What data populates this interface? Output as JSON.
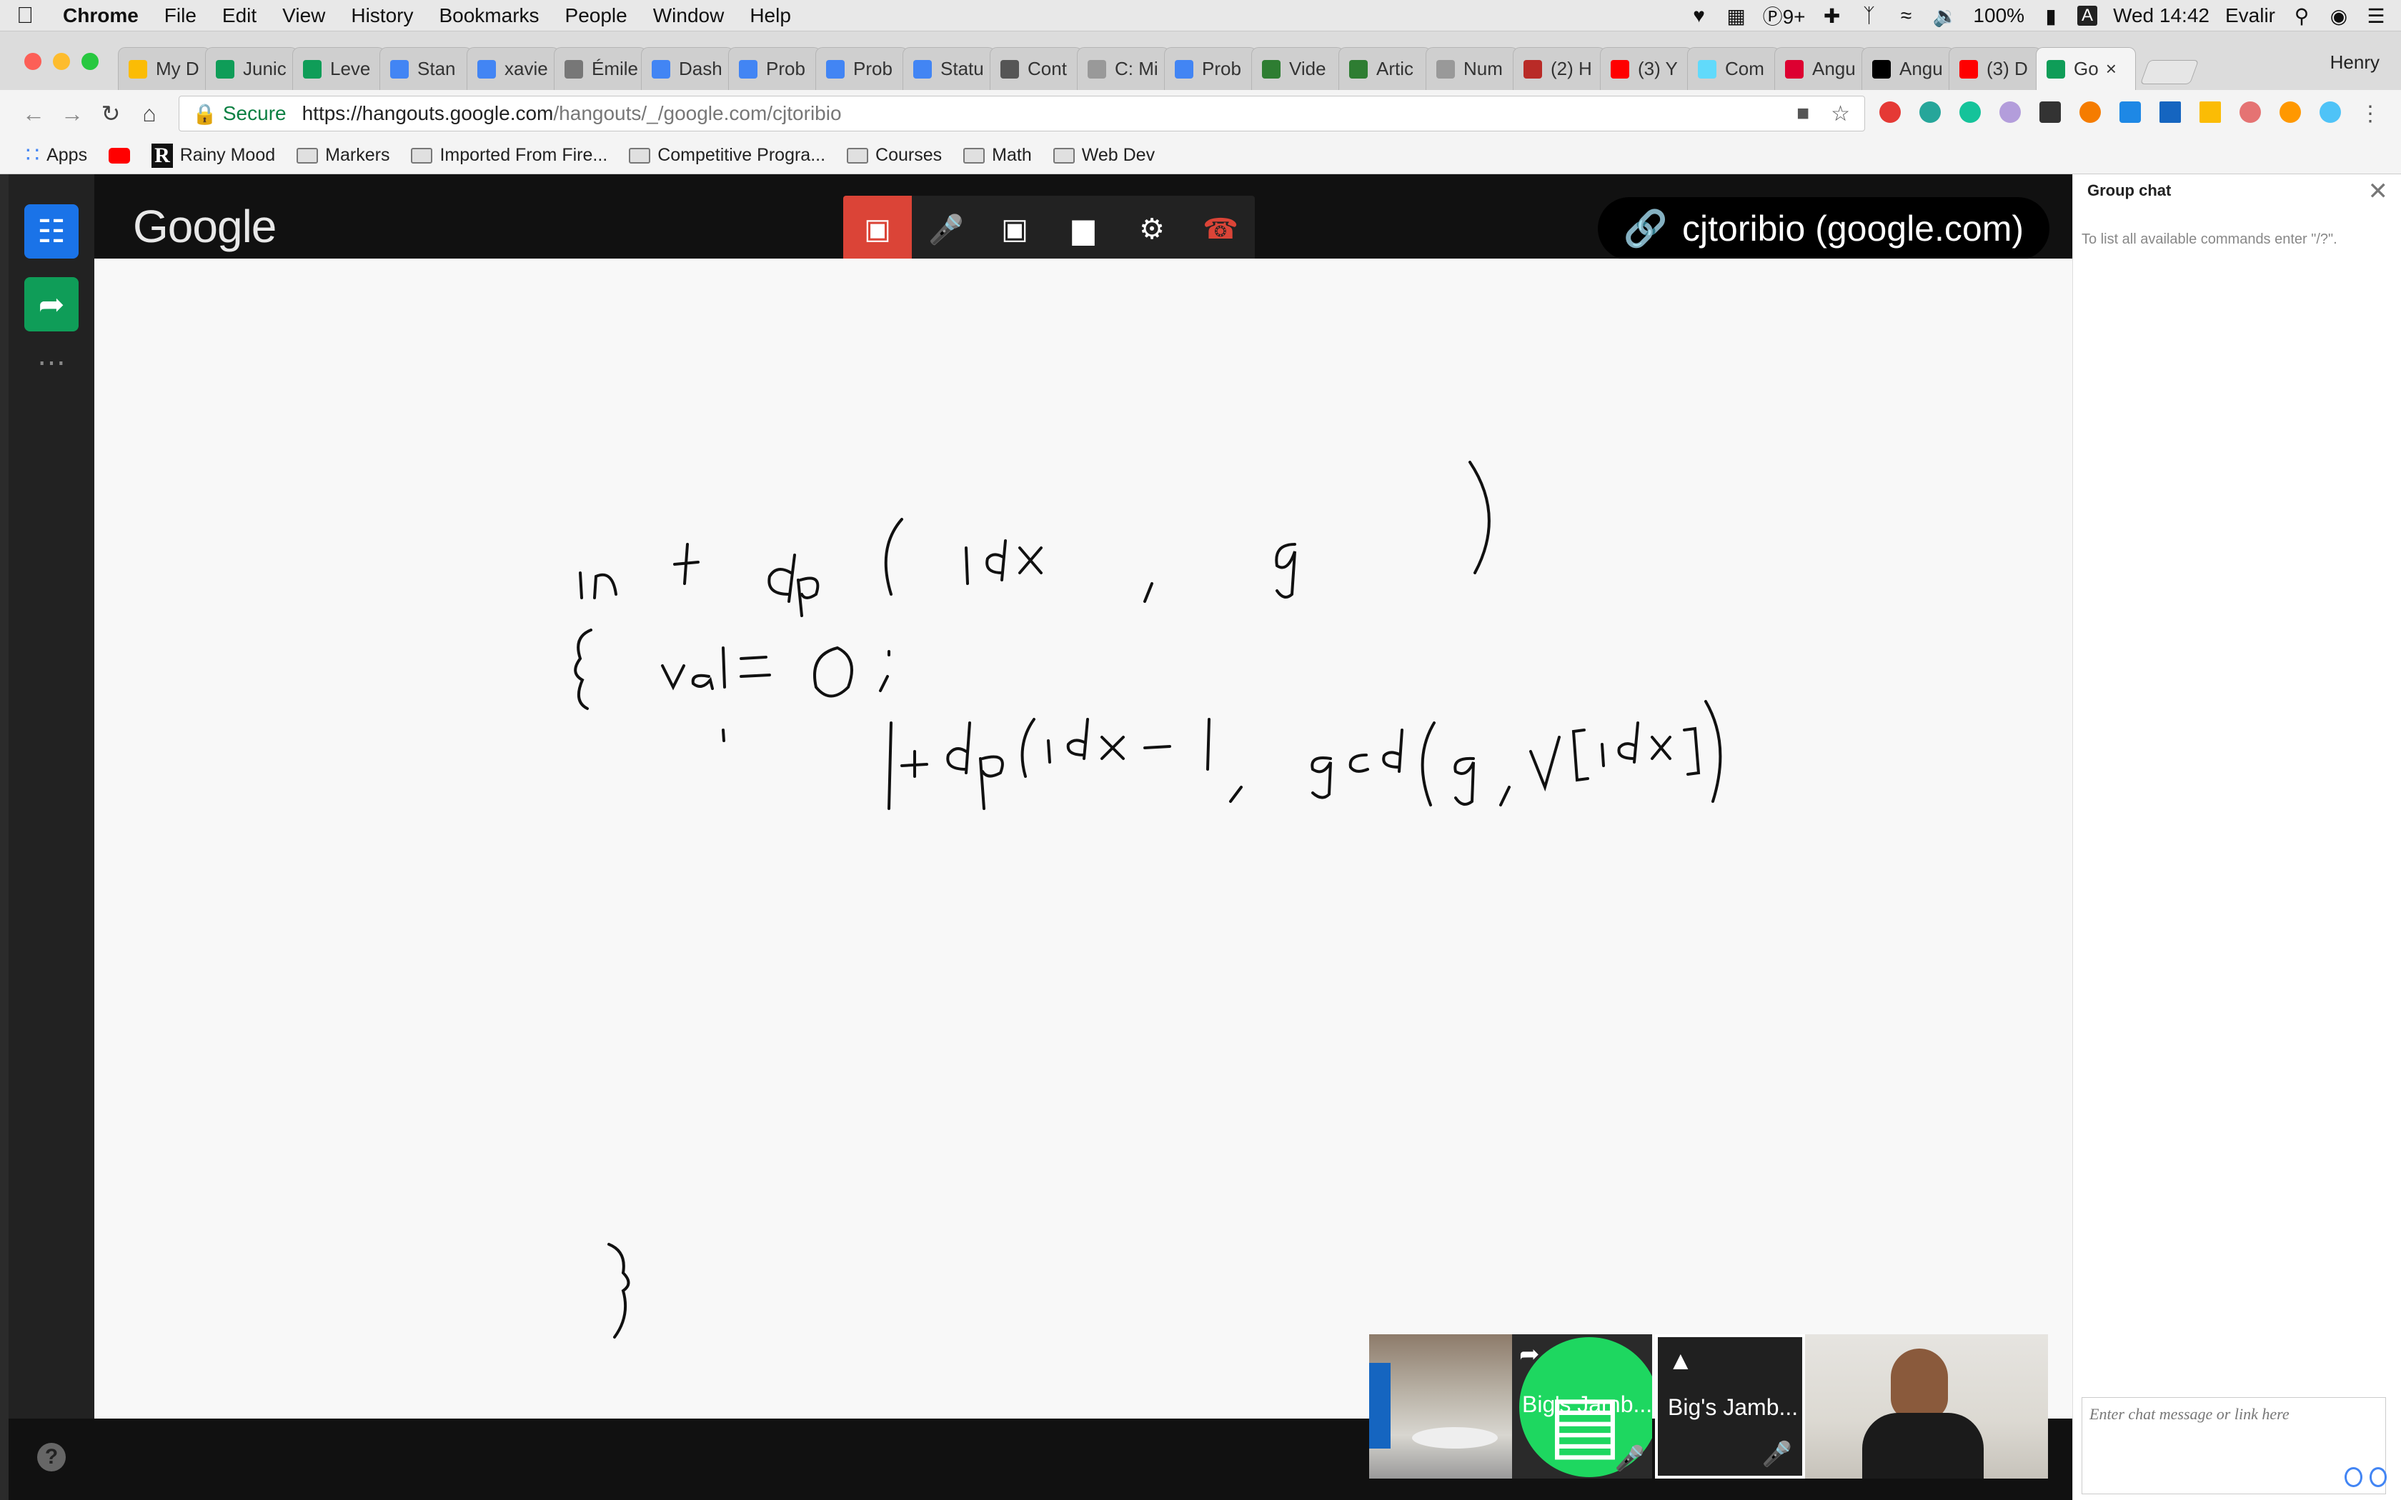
{
  "menubar": {
    "apple_icon": "apple-icon",
    "app_name": "Chrome",
    "items": [
      "File",
      "Edit",
      "View",
      "History",
      "Bookmarks",
      "People",
      "Window",
      "Help"
    ],
    "status_icons": [
      "evernote-icon",
      "grid-icon",
      "pushbullet-icon",
      "plus-icon",
      "bluetooth-icon",
      "wifi-icon",
      "volume-icon"
    ],
    "p_badge": "9+",
    "battery": "100%",
    "input_source": "A",
    "clock": "Wed 14:42",
    "user": "Evalir"
  },
  "tabs": [
    {
      "label": "My D",
      "favicon": "drive-icon",
      "color": "#fbbc05"
    },
    {
      "label": "Junic",
      "favicon": "sheets-icon",
      "color": "#0f9d58"
    },
    {
      "label": "Leve",
      "favicon": "sheets-icon",
      "color": "#0f9d58"
    },
    {
      "label": "Stan",
      "favicon": "chart-icon",
      "color": "#4285f4"
    },
    {
      "label": "xavie",
      "favicon": "chart-icon",
      "color": "#4285f4"
    },
    {
      "label": "Émile",
      "favicon": "wikipedia-icon",
      "color": "#777777"
    },
    {
      "label": "Dash",
      "favicon": "chart-icon",
      "color": "#4285f4"
    },
    {
      "label": "Prob",
      "favicon": "chart-icon",
      "color": "#4285f4"
    },
    {
      "label": "Prob",
      "favicon": "chart-icon",
      "color": "#4285f4"
    },
    {
      "label": "Statu",
      "favicon": "chart-icon",
      "color": "#4285f4"
    },
    {
      "label": "Cont",
      "favicon": "github-icon",
      "color": "#555555"
    },
    {
      "label": "C: Mi",
      "favicon": "file-icon",
      "color": "#999999"
    },
    {
      "label": "Prob",
      "favicon": "chart-icon",
      "color": "#4285f4"
    },
    {
      "label": "Vide",
      "favicon": "hex-icon",
      "color": "#2e7d32"
    },
    {
      "label": "Artic",
      "favicon": "hex-icon",
      "color": "#2e7d32"
    },
    {
      "label": "Num",
      "favicon": "file-icon",
      "color": "#999999"
    },
    {
      "label": "(2) H",
      "favicon": "quora-icon",
      "color": "#b92b27"
    },
    {
      "label": "(3) Y",
      "favicon": "youtube-icon",
      "color": "#ff0000"
    },
    {
      "label": "Com",
      "favicon": "react-icon",
      "color": "#61dafb"
    },
    {
      "label": "Angu",
      "favicon": "angular-icon",
      "color": "#dd0031"
    },
    {
      "label": "Angu",
      "favicon": "medium-icon",
      "color": "#000000"
    },
    {
      "label": "(3) D",
      "favicon": "youtube-icon",
      "color": "#ff0000"
    },
    {
      "label": "Go",
      "favicon": "hangouts-icon",
      "color": "#0f9d58",
      "active": true
    }
  ],
  "profile_name": "Henry",
  "address": {
    "secure_label": "Secure",
    "url_host": "https://hangouts.google.com",
    "url_path": "/hangouts/_/google.com/cjtoribio"
  },
  "bookmarks": [
    {
      "label": "Apps",
      "icon": "apps-grid-icon"
    },
    {
      "label": "",
      "icon": "youtube-icon"
    },
    {
      "label": "Rainy Mood",
      "icon": "r-icon"
    },
    {
      "label": "Markers",
      "icon": "folder-icon"
    },
    {
      "label": "Imported From Fire...",
      "icon": "folder-icon"
    },
    {
      "label": "Competitive Progra...",
      "icon": "folder-icon"
    },
    {
      "label": "Courses",
      "icon": "folder-icon"
    },
    {
      "label": "Math",
      "icon": "folder-icon"
    },
    {
      "label": "Web Dev",
      "icon": "folder-icon"
    }
  ],
  "hangouts": {
    "logo": "Google",
    "call_link": "cjtoribio (google.com)",
    "controls": [
      "picture-in-picture-icon",
      "mic-off-icon",
      "camera-off-icon",
      "signal-icon",
      "settings-icon",
      "hang-up-icon"
    ],
    "participants": [
      {
        "name": "",
        "kind": "room-camera"
      },
      {
        "name": "Big's Jamb...",
        "kind": "presenting"
      },
      {
        "name": "Big's Jamb...",
        "kind": "screen"
      },
      {
        "name": "",
        "kind": "person-camera"
      }
    ],
    "help_label": "?"
  },
  "whiteboard_lines": [
    "int dp( idx , g )",
    "{ val = 0 ;",
    "1 + dp(idx-1 , gcd(g, v[idx]))",
    "}"
  ],
  "chat": {
    "title": "Group chat",
    "hint": "To list all available commands enter \"/?\".",
    "input_placeholder": "Enter chat message or link here"
  },
  "colors": {
    "call_red": "#db4437",
    "presenting_green": "#1ed760",
    "secure_green": "#0b8043"
  }
}
